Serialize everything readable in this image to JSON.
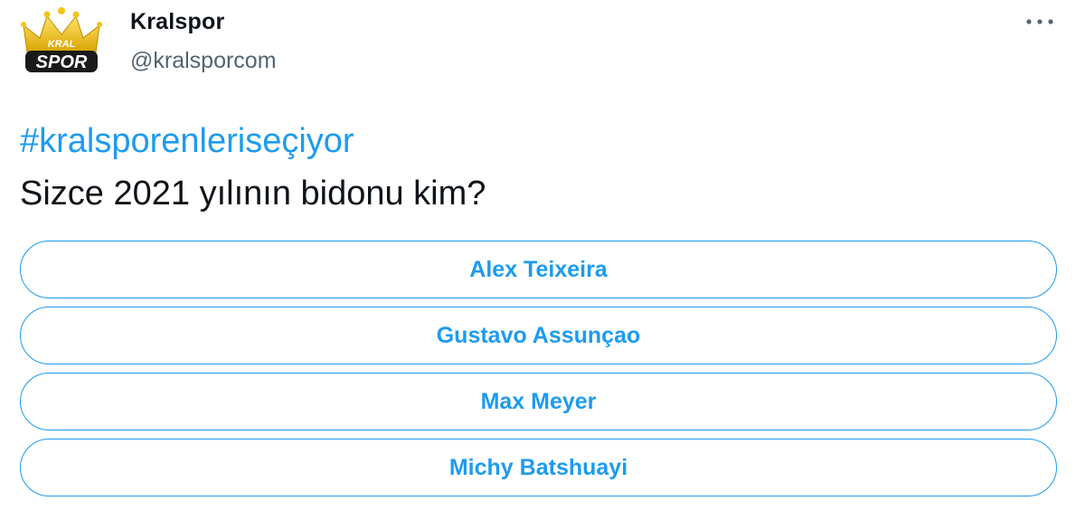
{
  "account": {
    "display_name": "Kralspor",
    "handle": "@kralsporcom",
    "avatar_icon": "kralspor-crown-logo",
    "logo_text_top": "KRAL",
    "logo_text_bottom": "SPOR"
  },
  "more_icon": "ellipsis-icon",
  "tweet": {
    "hashtag": "#kralsporenleriseçiyor",
    "text": "Sizce 2021 yılının bidonu kim?"
  },
  "poll": {
    "options": [
      {
        "label": "Alex Teixeira"
      },
      {
        "label": "Gustavo Assunçao"
      },
      {
        "label": "Max Meyer"
      },
      {
        "label": "Michy Batshuayi"
      }
    ]
  },
  "colors": {
    "accent": "#1d9bf0",
    "text_primary": "#0f1419",
    "text_secondary": "#536471",
    "logo_gold": "#f2c318"
  }
}
